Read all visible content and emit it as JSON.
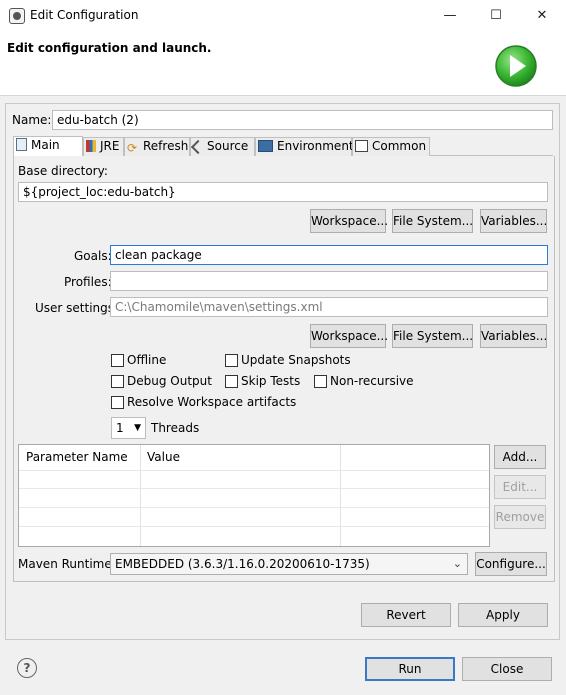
{
  "window": {
    "title": "Edit Configuration",
    "controls": {
      "minimize": "—",
      "maximize": "☐",
      "close": "✕"
    }
  },
  "banner": {
    "title": "Edit configuration and launch."
  },
  "name": {
    "label": "Name:",
    "value": "edu-batch (2)"
  },
  "tabs": [
    {
      "label": "Main",
      "icon": "page-icon",
      "active": true
    },
    {
      "label": "JRE",
      "icon": "books-icon"
    },
    {
      "label": "Refresh",
      "icon": "refresh-icon"
    },
    {
      "label": "Source",
      "icon": "source-icon"
    },
    {
      "label": "Environment",
      "icon": "environment-icon"
    },
    {
      "label": "Common",
      "icon": "common-icon"
    }
  ],
  "main": {
    "base_dir_label": "Base directory:",
    "base_dir_value": "${project_loc:edu-batch}",
    "workspace_btn": "Workspace...",
    "filesystem_btn": "File System...",
    "variables_btn": "Variables...",
    "goals_label": "Goals:",
    "goals_value": "clean package",
    "profiles_label": "Profiles:",
    "profiles_value": "",
    "user_settings_label": "User settings:",
    "user_settings_value": "C:\\Chamomile\\maven\\settings.xml",
    "offline": "Offline",
    "update_snapshots": "Update Snapshots",
    "debug_output": "Debug Output",
    "skip_tests": "Skip Tests",
    "non_recursive": "Non-recursive",
    "resolve_workspace": "Resolve Workspace artifacts",
    "threads_value": "1",
    "threads_label": "Threads",
    "table": {
      "headers": [
        "Parameter Name",
        "Value"
      ],
      "rows": []
    },
    "add_btn": "Add...",
    "edit_btn": "Edit...",
    "remove_btn": "Remove",
    "runtime_label": "Maven Runtime:",
    "runtime_value": "EMBEDDED (3.6.3/1.16.0.20200610-1735)",
    "configure_btn": "Configure..."
  },
  "actions": {
    "revert": "Revert",
    "apply": "Apply",
    "run": "Run",
    "close": "Close",
    "help": "?"
  },
  "colors": {
    "run_green": "#35b82f",
    "focus_blue": "#2b7bd6"
  }
}
